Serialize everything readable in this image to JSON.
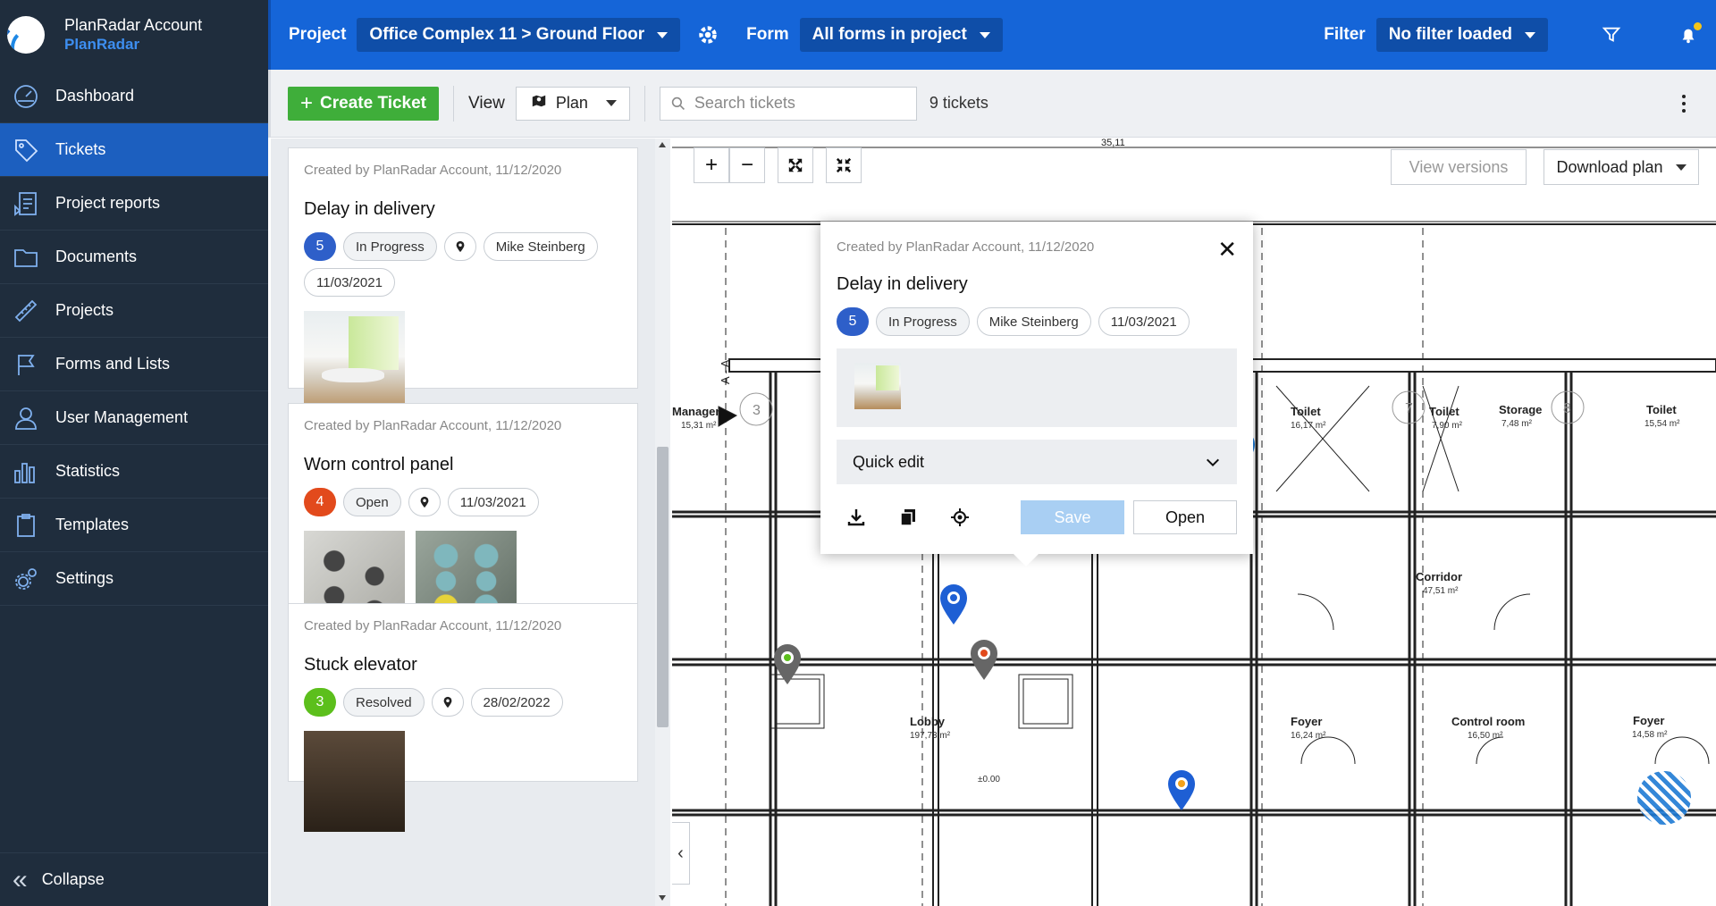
{
  "brand": {
    "account": "PlanRadar Account",
    "name": "PlanRadar"
  },
  "sidebar": {
    "items": [
      {
        "label": "Dashboard",
        "icon": "dashboard-icon"
      },
      {
        "label": "Tickets",
        "icon": "tag-icon",
        "active": true
      },
      {
        "label": "Project reports",
        "icon": "report-icon"
      },
      {
        "label": "Documents",
        "icon": "folder-icon"
      },
      {
        "label": "Projects",
        "icon": "ruler-icon"
      },
      {
        "label": "Forms and Lists",
        "icon": "flag-icon"
      },
      {
        "label": "User Management",
        "icon": "user-icon"
      },
      {
        "label": "Statistics",
        "icon": "bar-chart-icon"
      },
      {
        "label": "Templates",
        "icon": "clipboard-icon"
      },
      {
        "label": "Settings",
        "icon": "gear-icon"
      }
    ],
    "collapse": "Collapse"
  },
  "topbar": {
    "project_label": "Project",
    "project_value": "Office Complex 11 > Ground Floor",
    "form_label": "Form",
    "form_value": "All forms in project",
    "filter_label": "Filter",
    "filter_value": "No filter loaded"
  },
  "toolbar": {
    "create": "Create Ticket",
    "view_label": "View",
    "view_value": "Plan",
    "search_placeholder": "Search tickets",
    "count": "9 tickets"
  },
  "tickets": [
    {
      "meta": "Created by PlanRadar Account, 11/12/2020",
      "title": "Delay in delivery",
      "num": "5",
      "status": "In Progress",
      "assignee": "Mike Steinberg",
      "date": "11/03/2021",
      "color": "#2e5fc9"
    },
    {
      "meta": "Created by PlanRadar Account, 11/12/2020",
      "title": "Worn control panel",
      "num": "4",
      "status": "Open",
      "date": "11/03/2021",
      "color": "#e24a1c"
    },
    {
      "meta": "Created by PlanRadar Account, 11/12/2020",
      "title": "Stuck elevator",
      "num": "3",
      "status": "Resolved",
      "date": "28/02/2022",
      "color": "#5cbf1c"
    }
  ],
  "plan": {
    "view_versions": "View versions",
    "download": "Download plan",
    "labels": {
      "manager": "Manager",
      "manager_area": "15,31 m²",
      "toilet1": "Toilet",
      "toilet1_area": "16,17 m²",
      "toilet2": "Toilet",
      "toilet2_area": "7,90 m²",
      "storage": "Storage",
      "storage_area": "7,48 m²",
      "toilet3": "Toilet",
      "toilet3_area": "15,54 m²",
      "corridor": "Corridor",
      "corridor_area": "47,51 m²",
      "lobby": "Lobby",
      "lobby_area": "197,73 m²",
      "foyer1": "Foyer",
      "foyer1_area": "16,24 m²",
      "control": "Control room",
      "control_area": "16,50 m²",
      "foyer2": "Foyer",
      "foyer2_area": "14,58 m²",
      "level": "±0.00",
      "dim_top": "35,11",
      "section": "A - A",
      "grid3": "3",
      "grid7": "7",
      "grid8": "8"
    }
  },
  "popup": {
    "meta": "Created by PlanRadar Account, 11/12/2020",
    "title": "Delay in delivery",
    "num": "5",
    "status": "In Progress",
    "assignee": "Mike Steinberg",
    "date": "11/03/2021",
    "quick_edit": "Quick edit",
    "save": "Save",
    "open": "Open"
  }
}
